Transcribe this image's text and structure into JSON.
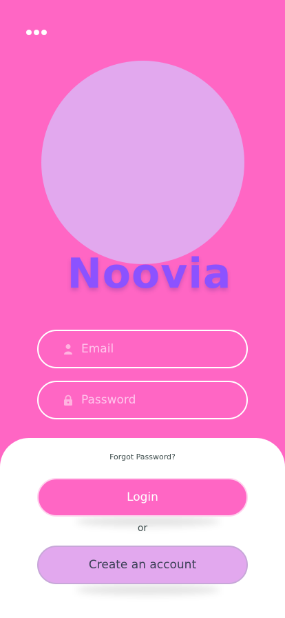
{
  "menu": {
    "icon": "more-horizontal-icon"
  },
  "brand": {
    "name": "Noovia"
  },
  "login_form": {
    "email": {
      "placeholder": "Email",
      "value": "",
      "icon": "user-icon"
    },
    "password": {
      "placeholder": "Password",
      "value": "",
      "icon": "lock-icon"
    },
    "forgot_label": "Forgot Password?",
    "login_label": "Login",
    "separator": "or",
    "create_account_label": "Create an account"
  },
  "colors": {
    "background": "#ff66c4",
    "hero_circle": "#e2a8ee",
    "brand_text": "#8c52ff",
    "sheet": "#ffffff"
  }
}
